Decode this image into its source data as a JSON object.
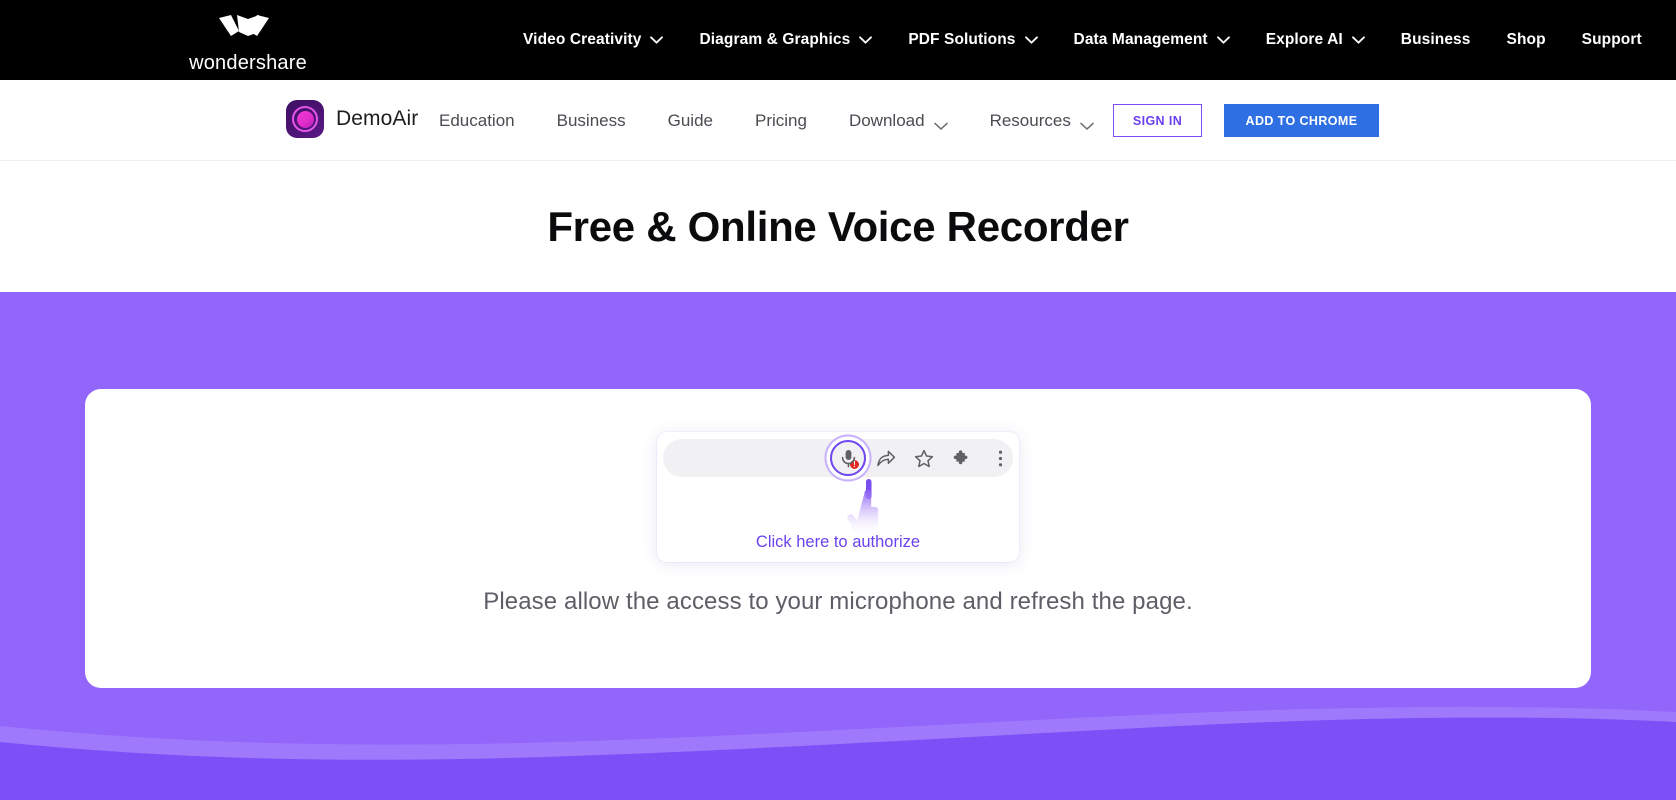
{
  "topbar": {
    "brand": {
      "name": "wondershare",
      "logo_icon": "wondershare-w-mark"
    },
    "nav": [
      {
        "label": "Video Creativity",
        "has_dropdown": true,
        "icon": "chevron-down-icon"
      },
      {
        "label": "Diagram & Graphics",
        "has_dropdown": true,
        "icon": "chevron-down-icon"
      },
      {
        "label": "PDF Solutions",
        "has_dropdown": true,
        "icon": "chevron-down-icon"
      },
      {
        "label": "Data Management",
        "has_dropdown": true,
        "icon": "chevron-down-icon"
      },
      {
        "label": "Explore AI",
        "has_dropdown": true,
        "icon": "chevron-down-icon"
      },
      {
        "label": "Business",
        "has_dropdown": false
      },
      {
        "label": "Shop",
        "has_dropdown": false
      },
      {
        "label": "Support",
        "has_dropdown": false
      }
    ]
  },
  "subnav": {
    "product": {
      "name": "DemoAir",
      "logo_icon": "demoair-circle-logo"
    },
    "links": [
      {
        "label": "Education",
        "has_dropdown": false
      },
      {
        "label": "Business",
        "has_dropdown": false
      },
      {
        "label": "Guide",
        "has_dropdown": false
      },
      {
        "label": "Pricing",
        "has_dropdown": false
      },
      {
        "label": "Download",
        "has_dropdown": true,
        "icon": "chevron-down-icon"
      },
      {
        "label": "Resources",
        "has_dropdown": true,
        "icon": "chevron-down-icon"
      }
    ],
    "sign_in_label": "SIGN IN",
    "add_to_chrome_label": "ADD TO CHROME"
  },
  "hero": {
    "title": "Free & Online Voice Recorder"
  },
  "card": {
    "authorize_label": "Click here to authorize",
    "message": "Please allow the access to your microphone and refresh the page.",
    "toolbar_icons": [
      {
        "name": "microphone-blocked-icon",
        "badge": "!"
      },
      {
        "name": "share-arrow-icon"
      },
      {
        "name": "star-bookmark-icon"
      },
      {
        "name": "puzzle-extensions-icon"
      },
      {
        "name": "three-dot-menu-icon"
      }
    ],
    "cursor_icon": "pointing-hand-cursor"
  },
  "colors": {
    "topbar_bg": "#000000",
    "purple_bg": "#9366fb",
    "wave_dark": "#7c4ff7",
    "wave_light": "#9f79fc",
    "accent_purple": "#6c40ef",
    "chrome_blue": "#2f6fe4",
    "badge_red": "#e0281f",
    "brand_magenta": "#e12ecb",
    "heading_text": "#0b0b0d",
    "body_text": "#5e5e66"
  }
}
